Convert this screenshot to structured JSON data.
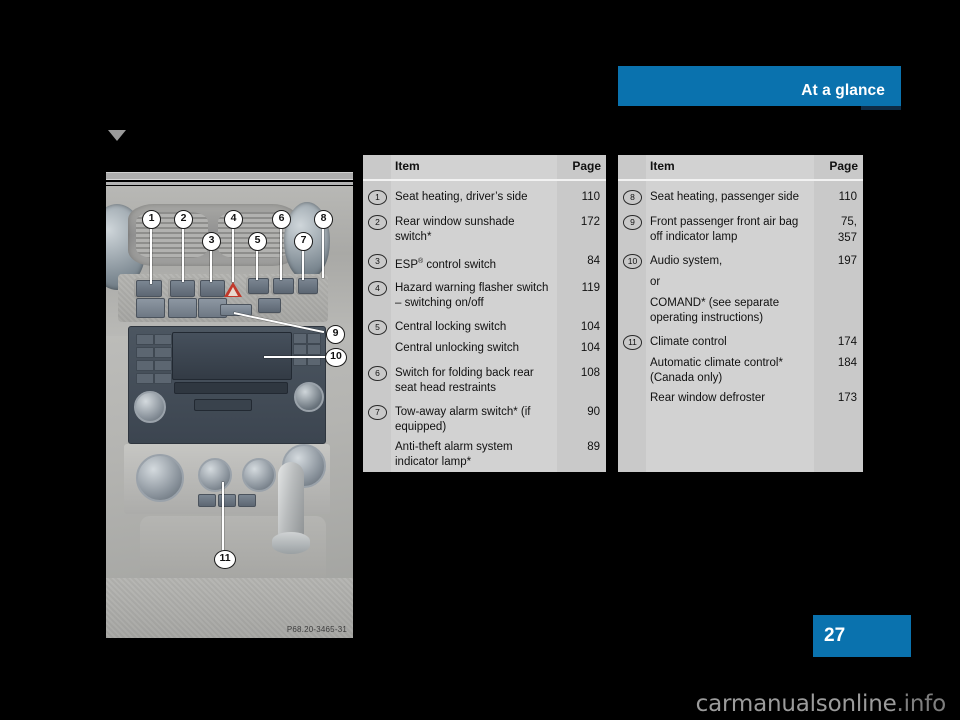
{
  "header": {
    "title": "At a glance",
    "accent_color": "#0a72ae",
    "shadow_color": "#0d2b45"
  },
  "figure": {
    "caption": "P68.20-3465-31",
    "callouts": [
      "1",
      "2",
      "3",
      "4",
      "5",
      "6",
      "7",
      "8",
      "9",
      "10",
      "11"
    ]
  },
  "tables": {
    "left": {
      "head_item": "Item",
      "head_page": "Page",
      "rows": [
        {
          "num": "1",
          "label": "Seat heating, driver’s side",
          "page": "110"
        },
        {
          "num": "2",
          "label": "Rear window sunshade switch*",
          "page": "172"
        },
        {
          "num": "3",
          "label": "ESP® control switch",
          "page": "84",
          "reg": true
        },
        {
          "num": "4",
          "label": "Hazard warning flasher switch – switching on/off",
          "page": "119"
        },
        {
          "num": "5",
          "label": "Central locking switch",
          "page": "104"
        },
        {
          "num": "",
          "label": "Central unlocking switch",
          "page": "104"
        },
        {
          "num": "6",
          "label": "Switch for folding back rear seat head restraints",
          "page": "108"
        },
        {
          "num": "7",
          "label": "Tow-away alarm switch* (if equipped)",
          "page": "90"
        },
        {
          "num": "",
          "label": "Anti-theft alarm system indicator lamp*",
          "page": "89"
        }
      ]
    },
    "right": {
      "head_item": "Item",
      "head_page": "Page",
      "rows": [
        {
          "num": "8",
          "label": "Seat heating, passenger side",
          "page": "110"
        },
        {
          "num": "9",
          "label": "Front passenger front air bag off indicator lamp",
          "page": "75,\n357"
        },
        {
          "num": "10",
          "label": "Audio system,",
          "page": "197"
        },
        {
          "num": "",
          "label": "or",
          "page": ""
        },
        {
          "num": "",
          "label": "COMAND* (see separate operating instructions)",
          "page": ""
        },
        {
          "num": "11",
          "label": "Climate control",
          "page": "174"
        },
        {
          "num": "",
          "label": "Automatic climate control* (Canada only)",
          "page": "184"
        },
        {
          "num": "",
          "label": "Rear window defroster",
          "page": "173"
        }
      ]
    }
  },
  "footer": {
    "page_number": "27",
    "watermark_main": "carmanualsonline",
    "watermark_suffix": ".info"
  }
}
